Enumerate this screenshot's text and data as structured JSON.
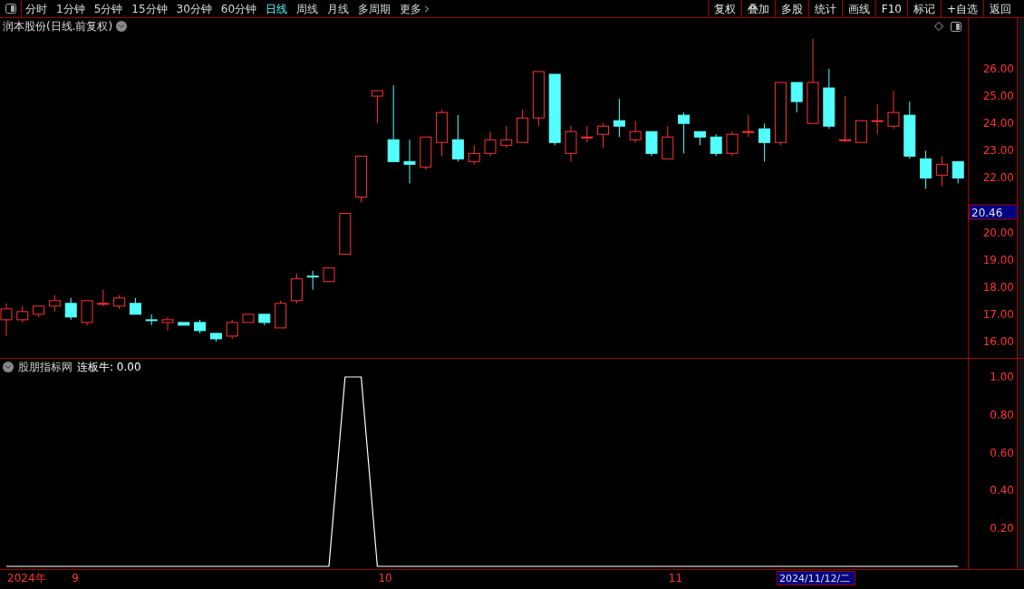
{
  "toolbar": {
    "periods": [
      {
        "label": "分时",
        "selected": false
      },
      {
        "label": "1分钟",
        "selected": false
      },
      {
        "label": "5分钟",
        "selected": false
      },
      {
        "label": "15分钟",
        "selected": false
      },
      {
        "label": "30分钟",
        "selected": false
      },
      {
        "label": "60分钟",
        "selected": false
      },
      {
        "label": "日线",
        "selected": true
      },
      {
        "label": "周线",
        "selected": false
      },
      {
        "label": "月线",
        "selected": false
      },
      {
        "label": "多周期",
        "selected": false
      },
      {
        "label": "更多",
        "selected": false
      }
    ],
    "actions": [
      "复权",
      "叠加",
      "多股",
      "统计",
      "画线",
      "F10",
      "标记",
      "+自选",
      "返回"
    ]
  },
  "price_chart": {
    "title": "润本股份(日线.前复权)",
    "price_tag": "20.46",
    "chart_data": {
      "type": "candlestick",
      "ylim": [
        15.4,
        27.86
      ],
      "yticks": [
        {
          "value": 26,
          "label": "26.00"
        },
        {
          "value": 25,
          "label": "25.00"
        },
        {
          "value": 24,
          "label": "24.00"
        },
        {
          "value": 23,
          "label": "23.00"
        },
        {
          "value": 22,
          "label": "22.00"
        },
        {
          "value": 20,
          "label": "20.00"
        },
        {
          "value": 19,
          "label": "19.00"
        },
        {
          "value": 18,
          "label": "18.00"
        },
        {
          "value": 17,
          "label": "17.00"
        },
        {
          "value": 16,
          "label": "16.00"
        }
      ],
      "ohlc": [
        [
          16.8,
          17.4,
          16.2,
          17.2
        ],
        [
          16.8,
          17.3,
          16.7,
          17.1
        ],
        [
          17.0,
          17.3,
          16.9,
          17.3
        ],
        [
          17.3,
          17.7,
          17.1,
          17.5
        ],
        [
          17.4,
          17.6,
          16.8,
          16.9
        ],
        [
          16.7,
          17.5,
          16.6,
          17.5
        ],
        [
          17.4,
          17.9,
          17.3,
          17.4
        ],
        [
          17.3,
          17.7,
          17.2,
          17.6
        ],
        [
          17.4,
          17.6,
          17.0,
          17.0
        ],
        [
          16.8,
          17.0,
          16.6,
          16.8
        ],
        [
          16.7,
          16.9,
          16.4,
          16.8
        ],
        [
          16.7,
          16.7,
          16.6,
          16.6
        ],
        [
          16.7,
          16.8,
          16.3,
          16.4
        ],
        [
          16.3,
          16.3,
          16.0,
          16.1
        ],
        [
          16.2,
          16.8,
          16.1,
          16.7
        ],
        [
          16.7,
          17.0,
          16.7,
          17.0
        ],
        [
          17.0,
          17.0,
          16.6,
          16.7
        ],
        [
          16.5,
          17.5,
          16.5,
          17.4
        ],
        [
          17.5,
          18.5,
          17.4,
          18.3
        ],
        [
          18.4,
          18.6,
          17.9,
          18.4
        ],
        [
          18.2,
          18.7,
          18.2,
          18.7
        ],
        [
          19.2,
          20.7,
          19.2,
          20.7
        ],
        [
          21.3,
          22.8,
          21.1,
          22.8
        ],
        [
          25.0,
          25.2,
          24.0,
          25.2
        ],
        [
          23.4,
          25.4,
          22.6,
          22.6
        ],
        [
          22.6,
          23.4,
          21.8,
          22.5
        ],
        [
          22.4,
          23.5,
          22.3,
          23.5
        ],
        [
          23.3,
          24.5,
          22.8,
          24.4
        ],
        [
          23.4,
          24.3,
          22.6,
          22.7
        ],
        [
          22.6,
          23.2,
          22.5,
          22.9
        ],
        [
          22.9,
          23.7,
          22.8,
          23.4
        ],
        [
          23.2,
          23.9,
          23.1,
          23.4
        ],
        [
          23.3,
          24.5,
          23.3,
          24.2
        ],
        [
          24.2,
          25.9,
          23.9,
          25.9
        ],
        [
          25.8,
          25.8,
          23.2,
          23.3
        ],
        [
          22.9,
          23.9,
          22.6,
          23.7
        ],
        [
          23.5,
          23.9,
          23.3,
          23.5
        ],
        [
          23.6,
          24.0,
          23.1,
          23.9
        ],
        [
          24.1,
          24.9,
          23.5,
          23.9
        ],
        [
          23.4,
          24.1,
          23.3,
          23.7
        ],
        [
          23.7,
          23.7,
          22.8,
          22.9
        ],
        [
          22.7,
          23.9,
          22.7,
          23.5
        ],
        [
          24.3,
          24.4,
          22.9,
          24.0
        ],
        [
          23.7,
          23.7,
          23.2,
          23.5
        ],
        [
          23.5,
          23.6,
          22.8,
          22.9
        ],
        [
          22.9,
          23.7,
          22.8,
          23.6
        ],
        [
          23.7,
          24.3,
          23.5,
          23.7
        ],
        [
          23.8,
          24.0,
          22.6,
          23.3
        ],
        [
          23.3,
          25.5,
          23.2,
          25.5
        ],
        [
          25.5,
          25.5,
          24.4,
          24.8
        ],
        [
          24.0,
          27.1,
          24.0,
          25.5
        ],
        [
          25.3,
          26.0,
          23.8,
          23.9
        ],
        [
          23.4,
          25.0,
          23.3,
          23.4
        ],
        [
          23.3,
          24.1,
          23.3,
          24.1
        ],
        [
          24.1,
          24.7,
          23.6,
          24.1
        ],
        [
          23.9,
          25.2,
          23.8,
          24.4
        ],
        [
          24.3,
          24.8,
          22.7,
          22.8
        ],
        [
          22.7,
          23.0,
          21.6,
          22.0
        ],
        [
          22.1,
          22.8,
          21.7,
          22.5
        ],
        [
          22.6,
          22.6,
          21.8,
          22.0
        ]
      ]
    }
  },
  "indicator": {
    "name": "股朋指标网",
    "reading": ": 0.00",
    "chart_data": {
      "type": "line",
      "ylim": [
        0,
        1.1
      ],
      "yticks": [
        {
          "value": 1,
          "label": "1.00"
        },
        {
          "value": 0.8,
          "label": "0.80"
        },
        {
          "value": 0.6,
          "label": "0.60"
        },
        {
          "value": 0.4,
          "label": "0.40"
        },
        {
          "value": 0.2,
          "label": "0.20"
        }
      ],
      "series": [
        {
          "name": "连板牛",
          "color": "#ffffff",
          "values": [
            0,
            0,
            0,
            0,
            0,
            0,
            0,
            0,
            0,
            0,
            0,
            0,
            0,
            0,
            0,
            0,
            0,
            0,
            0,
            0,
            0,
            1,
            1,
            0,
            0,
            0,
            0,
            0,
            0,
            0,
            0,
            0,
            0,
            0,
            0,
            0,
            0,
            0,
            0,
            0,
            0,
            0,
            0,
            0,
            0,
            0,
            0,
            0,
            0,
            0,
            0,
            0,
            0,
            0,
            0,
            0,
            0,
            0,
            0,
            0
          ]
        }
      ]
    }
  },
  "date_axis": {
    "labels": [
      "2024年",
      "9",
      "10",
      "11"
    ],
    "cursor_date": "2024/11/12/二"
  }
}
